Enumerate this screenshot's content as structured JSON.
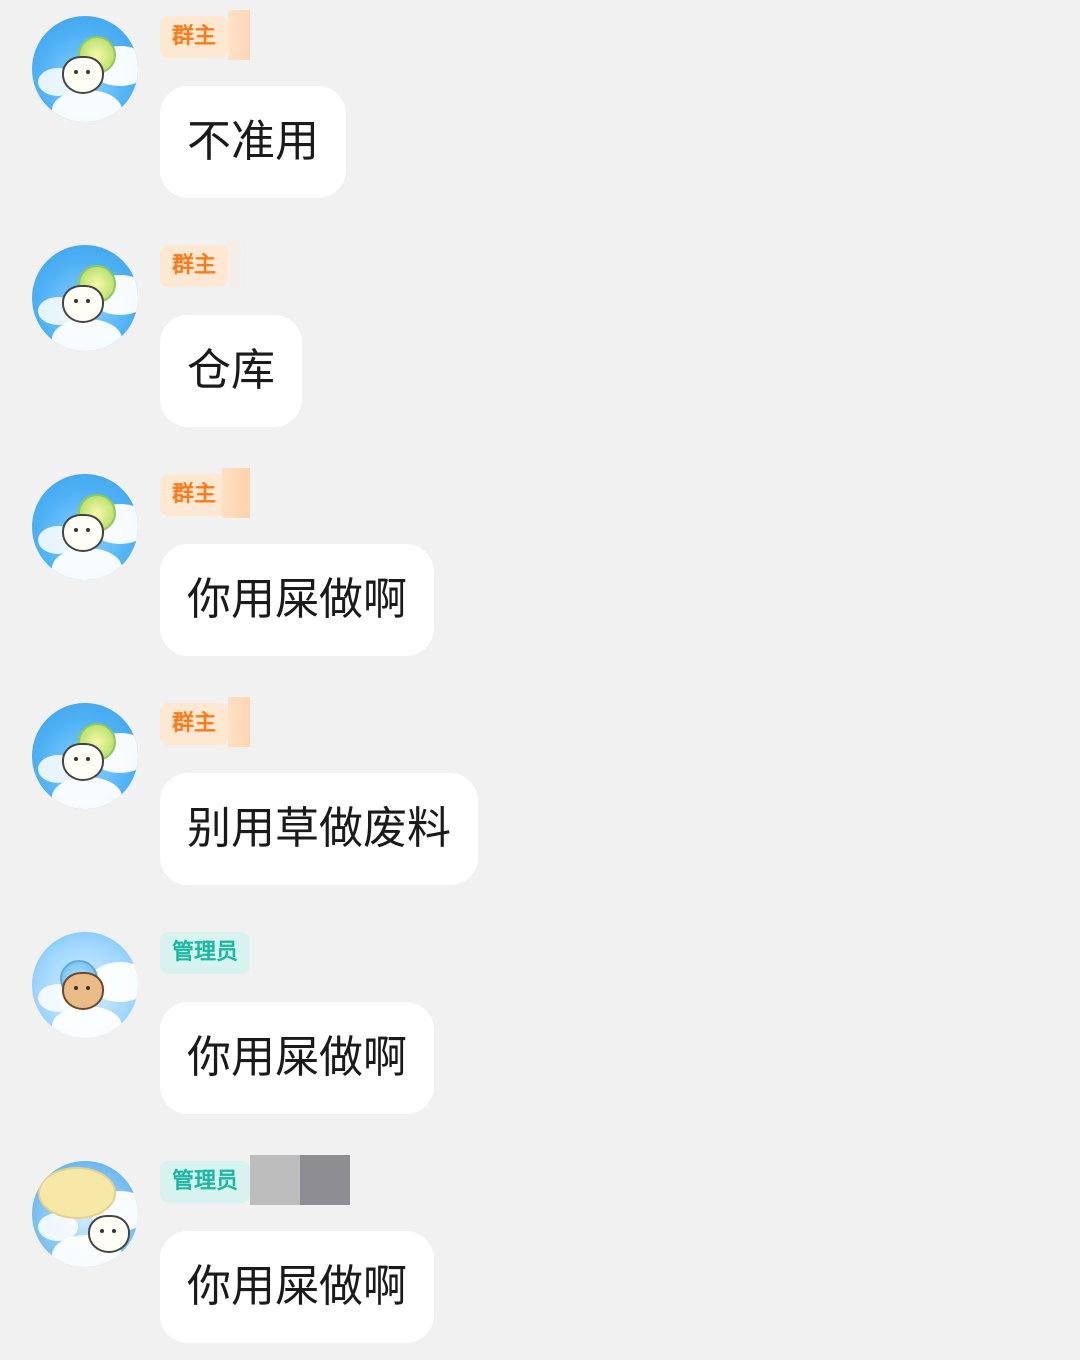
{
  "messages": [
    {
      "role": "群主",
      "text": "不准用"
    },
    {
      "role": "群主",
      "text": "仓库"
    },
    {
      "role": "群主",
      "text": "你用屎做啊"
    },
    {
      "role": "群主",
      "text": "别用草做废料"
    },
    {
      "role": "管理员",
      "text": "你用屎做啊"
    },
    {
      "role": "管理员",
      "text": "你用屎做啊"
    }
  ],
  "colors": {
    "background": "#f1f1f1",
    "owner_tag_bg": "#ffe8d2",
    "owner_tag_text": "#ff7a1a",
    "admin_tag_bg": "#d8f3ef",
    "admin_tag_text": "#19b8a1",
    "bubble_bg": "#ffffff"
  },
  "icons": {
    "owner_avatar": "bear-kite-avatar",
    "admin_avatar": "bear-kite-avatar"
  }
}
